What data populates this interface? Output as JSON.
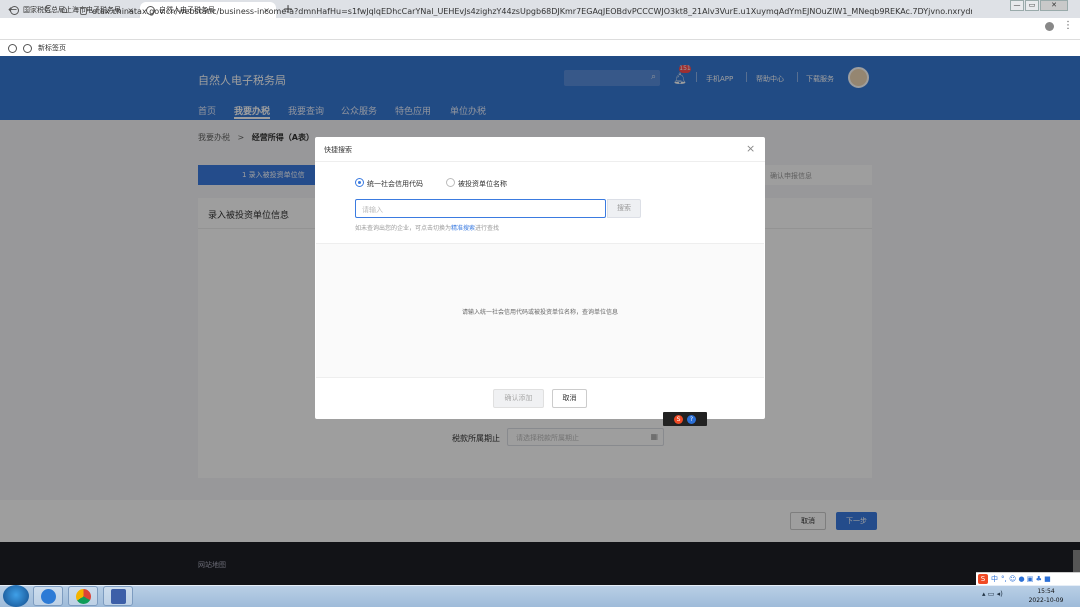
{
  "browser": {
    "tabs": [
      {
        "title": "国家税务总局上海市电子税务局",
        "close": "×"
      },
      {
        "title": "自然人电子税务局",
        "close": "×"
      }
    ],
    "new_tab": "+",
    "nav": {
      "back": "←",
      "forward": "→",
      "reload": "C",
      "home": "⌂"
    },
    "url": "etax.chinatax.gov.cn/webstatic/business-income-a?dmnHafHu=s1fwJqlqEDhcCarYNal_UEHEvJs4zighzY44zsUpgb68DJKmr7EGAqJEOBdvPCCCWJO3kt8_21Alv3VurE.u1XuymqAdYmEJNOuZlW1_MNeqb9REKAc.7DYjvno.nxrydrXH9iApJN3",
    "bookmarks": [
      {
        "label": "新标签页"
      }
    ],
    "window_controls": [
      "—",
      "▭",
      "✕"
    ]
  },
  "header": {
    "title": "自然人电子税务局",
    "nav": [
      "首页",
      "我要办税",
      "我要查询",
      "公众服务",
      "特色应用",
      "单位办税"
    ],
    "active_nav": "我要办税",
    "notification_count": "151",
    "links": [
      "手机APP",
      "帮助中心",
      "下载服务"
    ]
  },
  "page": {
    "breadcrumb_parent": "我要办税",
    "breadcrumb_sep": ">",
    "breadcrumb_current": "经营所得（A表）",
    "step1": "1  录入被投资单位信",
    "step_confirm": "确认申报信息",
    "panel_title": "录入被投资单位信息",
    "period_label": "税款所属期止",
    "period_placeholder": "请选择税款所属期止",
    "btn_cancel": "取消",
    "btn_next": "下一步",
    "footer_link": "网站地图"
  },
  "modal": {
    "title": "快捷搜索",
    "close": "×",
    "radio_options": [
      "统一社会信用代码",
      "被投资单位名称"
    ],
    "selected": "统一社会信用代码",
    "input_placeholder": "请输入",
    "search_button": "搜索",
    "hint_before": "如未查询出您的企业，可点击切换为",
    "hint_link": "精准搜索",
    "hint_after": "进行查找",
    "empty_message": "请输入统一社会信用代码或被投资单位名称，查询单位信息",
    "confirm_button": "确认添加",
    "cancel_button": "取消"
  },
  "ime_tray": {
    "label": "中"
  },
  "clock": {
    "time": "15:54",
    "date": "2022-10-09"
  },
  "colors": {
    "brand": "#3679d6",
    "primary": "#3b7be0",
    "badge": "#ff4d4f"
  }
}
